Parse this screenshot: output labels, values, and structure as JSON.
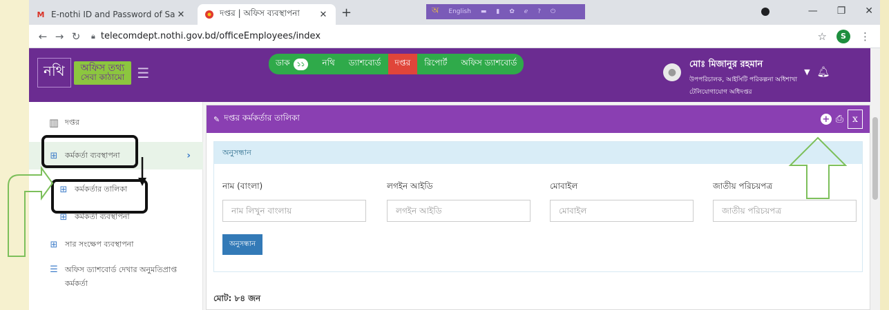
{
  "browser": {
    "tabs": [
      {
        "title": "E-nothi ID and Password of Sayma",
        "favicon": "gmail-icon"
      },
      {
        "title": "দপ্তর | অফিস ব্যবস্থাপনা",
        "favicon": "nothi-icon"
      }
    ],
    "extension_label": "English",
    "url": "telecomdept.nothi.gov.bd/officeEmployees/index",
    "profile_initial": "S"
  },
  "header": {
    "logo_text": "নথি",
    "logo_tagline_1": "অফিস তথ্য",
    "logo_tagline_2": "সেবা কাঠামো",
    "nav": [
      {
        "label": "ডাক",
        "badge": "১১"
      },
      {
        "label": "নথি"
      },
      {
        "label": "ড্যাশবোর্ড"
      },
      {
        "label": "দপ্তর",
        "active": true
      },
      {
        "label": "রিপোর্ট"
      },
      {
        "label": "অফিস ড্যাশবোর্ড"
      }
    ],
    "user": {
      "name": "মোঃ মিজানুর রহমান",
      "designation": "উপপরিচালক, আইসিটি পরিকল্পনা অধিশাখা",
      "office": "টেলিযোগাযোগ অধিদপ্তর"
    }
  },
  "sidebar": {
    "office": "দপ্তর",
    "employee_management": "কর্মকর্তা ব্যবস্থাপনা",
    "employee_list": "কর্মকর্তার তালিকা",
    "employee_manage_sub": "কর্মকর্তা ব্যবস্থাপনা",
    "summary_management": "সার সংক্ষেপ ব্যবস্থাপনা",
    "dashboard_permission": "অফিস ড্যাশবোর্ড দেখার অনুমতিপ্রাপ্ত কর্মকর্তা"
  },
  "main": {
    "panel_title": "দপ্তর কর্মকর্তার তালিকা",
    "search_title": "অনুসন্ধান",
    "fields": {
      "name_label": "নাম (বাংলা)",
      "name_placeholder": "নাম লিখুন বাংলায়",
      "login_label": "লগইন আইডি",
      "login_placeholder": "লগইন আইডি",
      "mobile_label": "মোবাইল",
      "mobile_placeholder": "মোবাইল",
      "nid_label": "জাতীয় পরিচয়পত্র",
      "nid_placeholder": "জাতীয় পরিচয়পত্র"
    },
    "search_button": "অনুসন্ধান",
    "total": "মোট: ৮৪ জন"
  },
  "colors": {
    "header_purple": "#6b2c91",
    "panel_purple": "#8a3fb2",
    "nav_green": "#2faa4a",
    "nav_active_red": "#e0453a",
    "annotation_green": "#7cbf5a"
  }
}
